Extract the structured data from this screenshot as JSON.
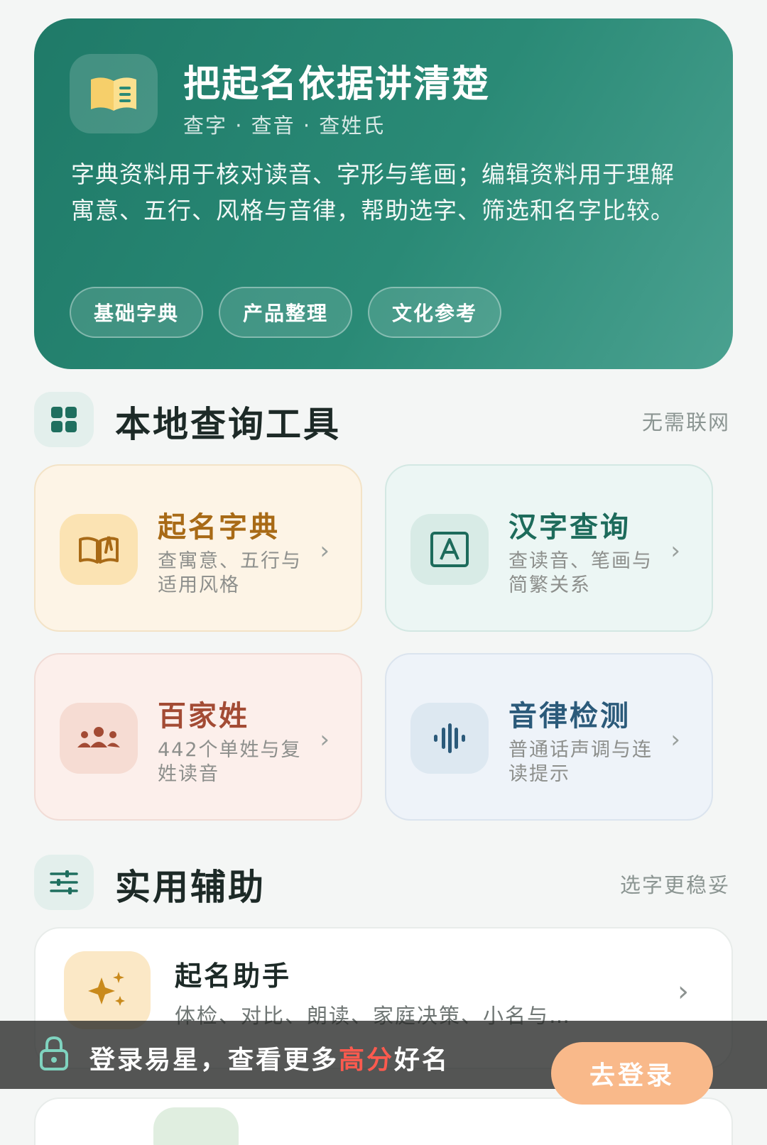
{
  "hero": {
    "title": "把起名依据讲清楚",
    "subtitle": "查字 · 查音 · 查姓氏",
    "description": "字典资料用于核对读音、字形与笔画；编辑资料用于理解寓意、五行、风格与音律，帮助选字、筛选和名字比较。",
    "tags": [
      "基础字典",
      "产品整理",
      "文化参考"
    ],
    "icon": "book-icon"
  },
  "section_tools": {
    "title": "本地查询工具",
    "right_text": "无需联网",
    "icon": "grid-icon"
  },
  "tools": [
    {
      "title": "起名字典",
      "desc": "查寓意、五行与适用风格",
      "icon": "open-book-icon",
      "color": "#a86a16"
    },
    {
      "title": "汉字查询",
      "desc": "查读音、笔画与简繁关系",
      "icon": "letter-a-icon",
      "color": "#1d6b5b"
    },
    {
      "title": "百家姓",
      "desc": "442个单姓与复姓读音",
      "icon": "people-icon",
      "color": "#a34b34"
    },
    {
      "title": "音律检测",
      "desc": "普通话声调与连读提示",
      "icon": "soundwave-icon",
      "color": "#2b5a7a"
    }
  ],
  "section_assist": {
    "title": "实用辅助",
    "right_text": "选字更稳妥",
    "icon": "sliders-icon"
  },
  "assistant": {
    "title": "起名助手",
    "desc": "体检、对比、朗读、家庭决策、小名与…",
    "icon": "sparkle-icon"
  },
  "login_banner": {
    "text_before": "登录易星，查看更多",
    "text_highlight": "高分",
    "text_after": "好名",
    "button": "去登录",
    "icon": "lock-icon",
    "highlight_color": "#ff5a4e",
    "button_color": "#f9b98a"
  }
}
